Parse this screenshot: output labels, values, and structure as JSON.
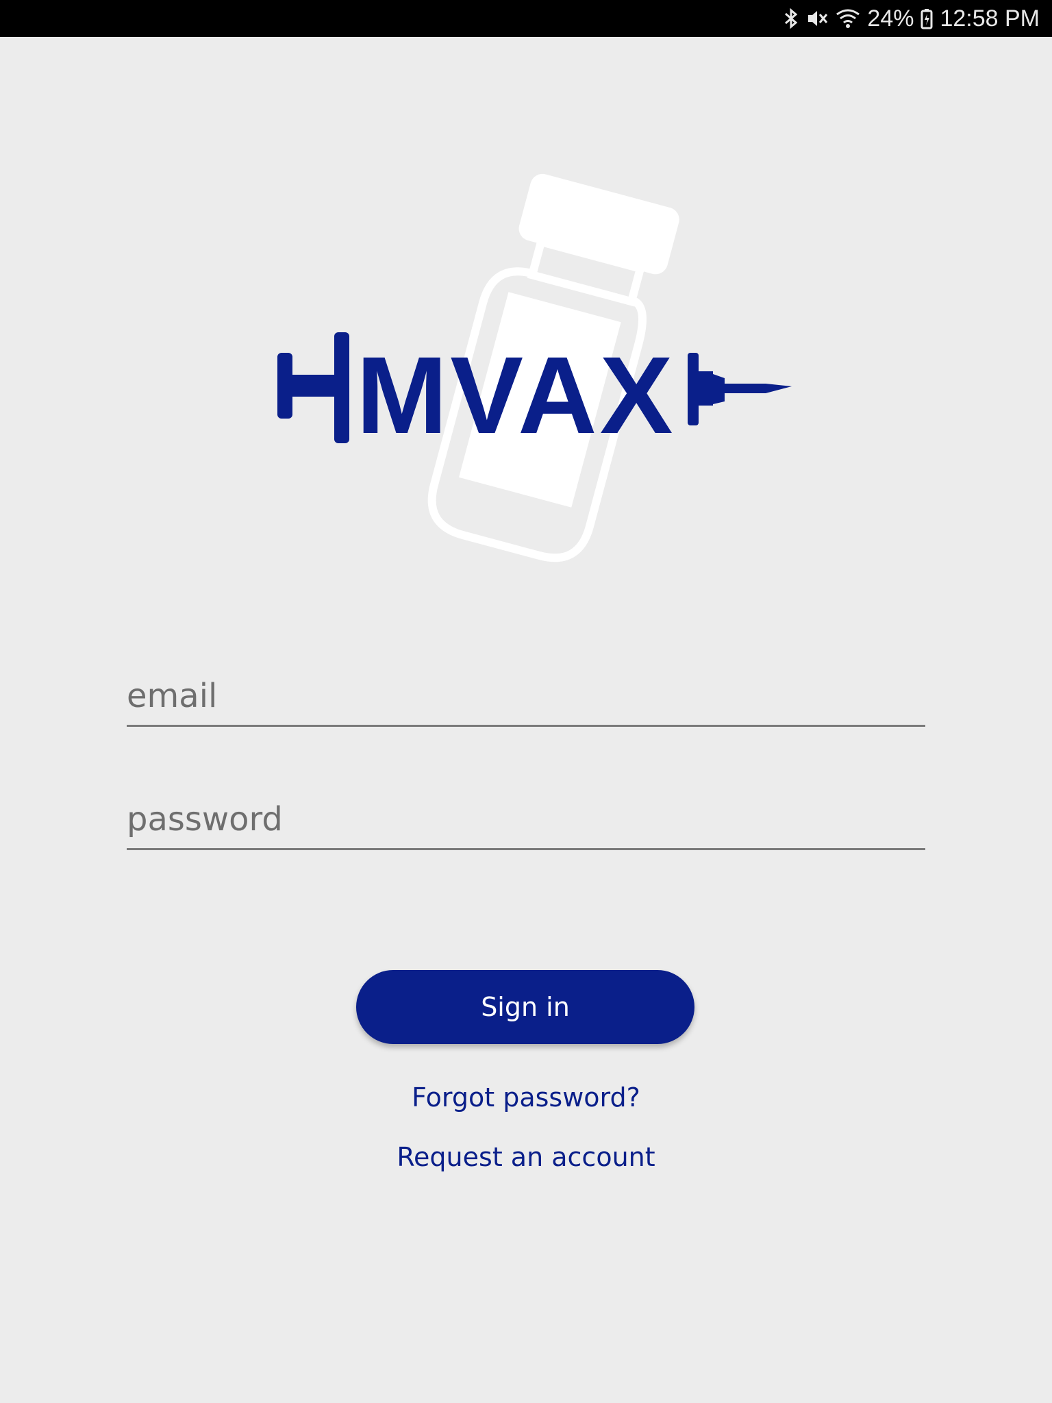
{
  "status_bar": {
    "battery": "24%",
    "time": "12:58 PM",
    "icons": [
      "bluetooth-icon",
      "vibrate-mute-icon",
      "wifi-icon",
      "battery-icon"
    ]
  },
  "logo": {
    "text": "MVAX"
  },
  "form": {
    "email_placeholder": "email",
    "password_placeholder": "password",
    "signin_label": "Sign in",
    "forgot_label": "Forgot password?",
    "request_label": "Request an account"
  },
  "colors": {
    "brand": "#0a1f8a",
    "background": "#ececec",
    "status_bar": "#000000"
  }
}
